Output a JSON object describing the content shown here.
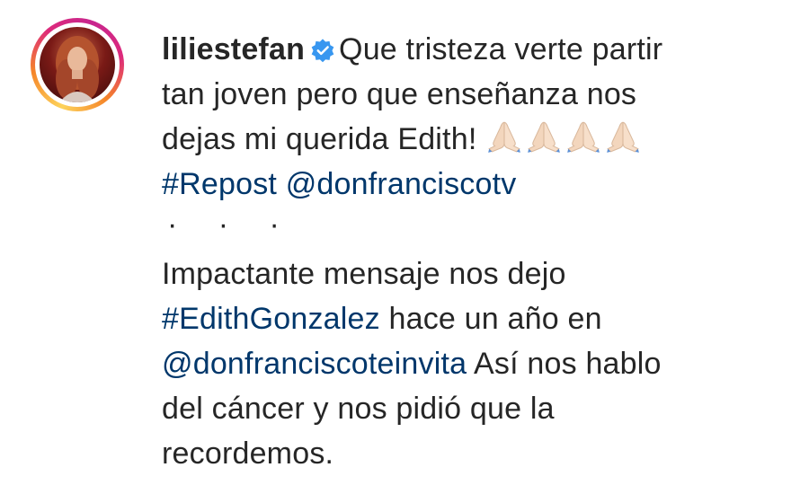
{
  "post": {
    "username": "liliestefan",
    "verified": true,
    "caption_lines": [
      "Que tristeza verte partir",
      "tan joven pero que enseñanza nos",
      "dejas mi querida Edith!"
    ],
    "emoji": "folded-hands-light-skin",
    "emoji_count": 4,
    "repost_hashtag": "#Repost",
    "repost_mention": "@donfranciscotv",
    "ellipsis": "· · ·",
    "body": {
      "line1": "Impactante mensaje nos dejo",
      "hashtag": "#EdithGonzalez",
      "line2_rest": " hace un año en",
      "mention": "@donfranciscoteinvita",
      "line3_rest": " Así nos hablo",
      "line4": "del cáncer y nos pidió que la",
      "line5": "recordemos."
    }
  },
  "colors": {
    "text": "#262626",
    "link": "#00376b",
    "verified": "#3897f0"
  }
}
